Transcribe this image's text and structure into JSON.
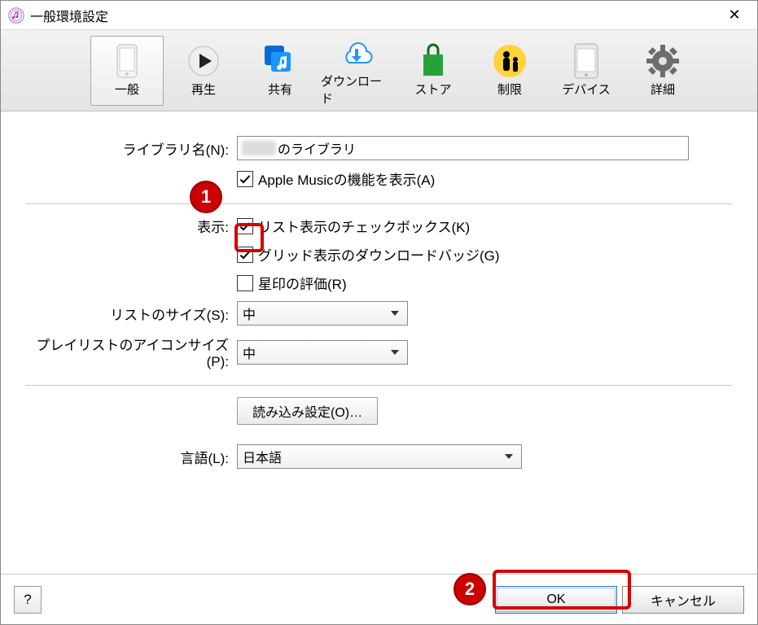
{
  "window": {
    "title": "一般環境設定"
  },
  "toolbar": {
    "items": [
      {
        "id": "general",
        "label": "一般",
        "selected": true
      },
      {
        "id": "playback",
        "label": "再生",
        "selected": false
      },
      {
        "id": "sharing",
        "label": "共有",
        "selected": false
      },
      {
        "id": "download",
        "label": "ダウンロード",
        "selected": false
      },
      {
        "id": "store",
        "label": "ストア",
        "selected": false
      },
      {
        "id": "parental",
        "label": "制限",
        "selected": false
      },
      {
        "id": "devices",
        "label": "デバイス",
        "selected": false
      },
      {
        "id": "advanced",
        "label": "詳細",
        "selected": false
      }
    ]
  },
  "form": {
    "library_name_label": "ライブラリ名(N):",
    "library_name_value": "のライブラリ",
    "apple_music_checkbox": {
      "checked": true,
      "label": "Apple Musicの機能を表示(A)"
    },
    "display_label": "表示:",
    "display_options": [
      {
        "id": "list_checkbox",
        "checked": true,
        "label": "リスト表示のチェックボックス(K)"
      },
      {
        "id": "grid_badge",
        "checked": true,
        "label": "グリッド表示のダウンロードバッジ(G)"
      },
      {
        "id": "star_rating",
        "checked": false,
        "label": "星印の評価(R)"
      }
    ],
    "list_size_label": "リストのサイズ(S):",
    "list_size_value": "中",
    "playlist_icon_size_label": "プレイリストのアイコンサイズ(P):",
    "playlist_icon_size_value": "中",
    "import_settings_button": "読み込み設定(O)…",
    "language_label": "言語(L):",
    "language_value": "日本語"
  },
  "footer": {
    "help": "?",
    "ok": "OK",
    "cancel": "キャンセル"
  },
  "annotations": {
    "b1": "1",
    "b2": "2"
  }
}
